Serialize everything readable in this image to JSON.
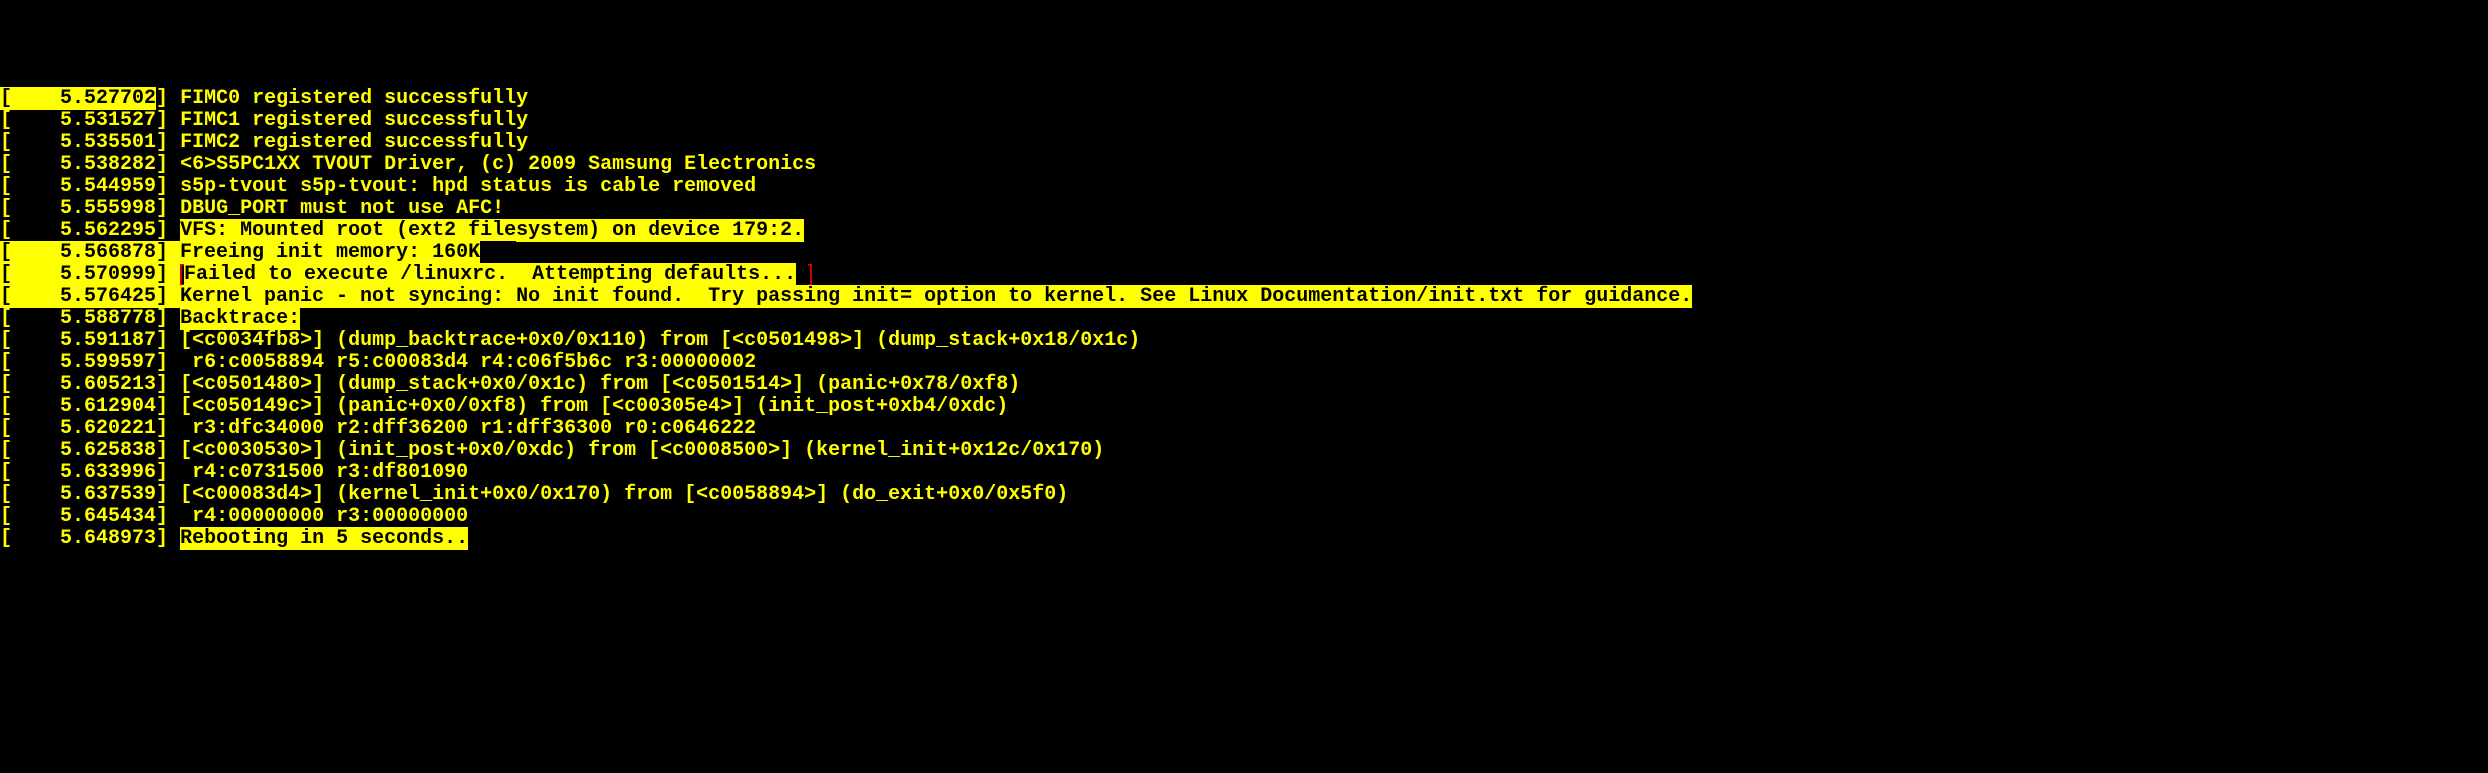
{
  "lines": [
    {
      "ts": "5.527702",
      "msg": "FIMC0 registered successfully",
      "style": "plain",
      "ts_hl": true
    },
    {
      "ts": "5.531527",
      "msg": "FIMC1 registered successfully",
      "style": "plain"
    },
    {
      "ts": "5.535501",
      "msg": "FIMC2 registered successfully",
      "style": "plain"
    },
    {
      "ts": "5.538282",
      "msg": "<6>S5PC1XX TVOUT Driver, (c) 2009 Samsung Electronics",
      "style": "plain"
    },
    {
      "ts": "5.544959",
      "msg": "s5p-tvout s5p-tvout: hpd status is cable removed",
      "style": "plain"
    },
    {
      "ts": "5.555998",
      "msg": "DBUG_PORT must not use AFC!",
      "style": "plain"
    },
    {
      "ts": "5.562295",
      "msg": "VFS: Mounted root (ext2 filesystem) on device 179:2.",
      "style": "hl"
    },
    {
      "ts": "5.566878",
      "msg": "Freeing init memory: 160K",
      "style": "hl-ts-prefix",
      "trail": true
    },
    {
      "ts": "5.570999",
      "msg": "Failed to execute /linuxrc.  Attempting defaults...",
      "style": "boxed",
      "ts_hl": true
    },
    {
      "ts": "5.576425",
      "msg": "Kernel panic - not syncing: No init found.  Try passing init= option to kernel. See Linux Documentation/init.txt for guidance.",
      "style": "hl-full"
    },
    {
      "ts": "5.588778",
      "msg": "Backtrace:",
      "style": "hl"
    },
    {
      "ts": "5.591187",
      "msg": "[<c0034fb8>] (dump_backtrace+0x0/0x110) from [<c0501498>] (dump_stack+0x18/0x1c)",
      "style": "plain"
    },
    {
      "ts": "5.599597",
      "msg": " r6:c0058894 r5:c00083d4 r4:c06f5b6c r3:00000002",
      "style": "plain"
    },
    {
      "ts": "5.605213",
      "msg": "[<c0501480>] (dump_stack+0x0/0x1c) from [<c0501514>] (panic+0x78/0xf8)",
      "style": "plain"
    },
    {
      "ts": "5.612904",
      "msg": "[<c050149c>] (panic+0x0/0xf8) from [<c00305e4>] (init_post+0xb4/0xdc)",
      "style": "plain"
    },
    {
      "ts": "5.620221",
      "msg": " r3:dfc34000 r2:dff36200 r1:dff36300 r0:c0646222",
      "style": "plain"
    },
    {
      "ts": "5.625838",
      "msg": "[<c0030530>] (init_post+0x0/0xdc) from [<c0008500>] (kernel_init+0x12c/0x170)",
      "style": "plain"
    },
    {
      "ts": "5.633996",
      "msg": " r4:c0731500 r3:df801090",
      "style": "plain"
    },
    {
      "ts": "5.637539",
      "msg": "[<c00083d4>] (kernel_init+0x0/0x170) from [<c0058894>] (do_exit+0x0/0x5f0)",
      "style": "plain"
    },
    {
      "ts": "5.645434",
      "msg": " r4:00000000 r3:00000000",
      "style": "plain"
    },
    {
      "ts": "5.648973",
      "msg": "Rebooting in 5 seconds..",
      "style": "hl",
      "trail": true
    }
  ]
}
